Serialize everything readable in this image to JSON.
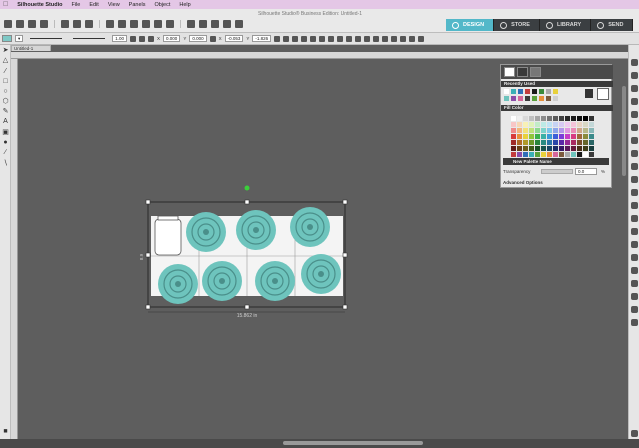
{
  "menubar": {
    "app_name": "Silhouette Studio",
    "items": [
      "File",
      "Edit",
      "View",
      "Panels",
      "Object",
      "Help"
    ]
  },
  "window": {
    "title": "Silhouette Studio® Business Edition: Untitled-1",
    "doc_tab": "Untitled-1"
  },
  "tabs": [
    {
      "label": "DESIGN",
      "active": true
    },
    {
      "label": "STORE",
      "active": false
    },
    {
      "label": "LIBRARY",
      "active": false
    },
    {
      "label": "SEND",
      "active": false
    }
  ],
  "toolbar": {
    "line_weight": "1.00",
    "x_value": "0.000",
    "y_value": "0.000",
    "x_off": "-0.053",
    "y_off": "-1.826"
  },
  "canvas": {
    "selection_width_label": "15.862 in",
    "selection_height_label": "8.9"
  },
  "panel": {
    "recent_header": "Recently Used",
    "fill_header": "Fill Color",
    "palette_name": "New Palette Name",
    "transparency_label": "Transparency",
    "transparency_value": "0.0",
    "transparency_unit": "%",
    "advanced_label": "Advanced Options"
  },
  "colors": {
    "accent": "#53b8c9",
    "flower": "#6ec4bd",
    "paper": "#f4f4f4"
  }
}
